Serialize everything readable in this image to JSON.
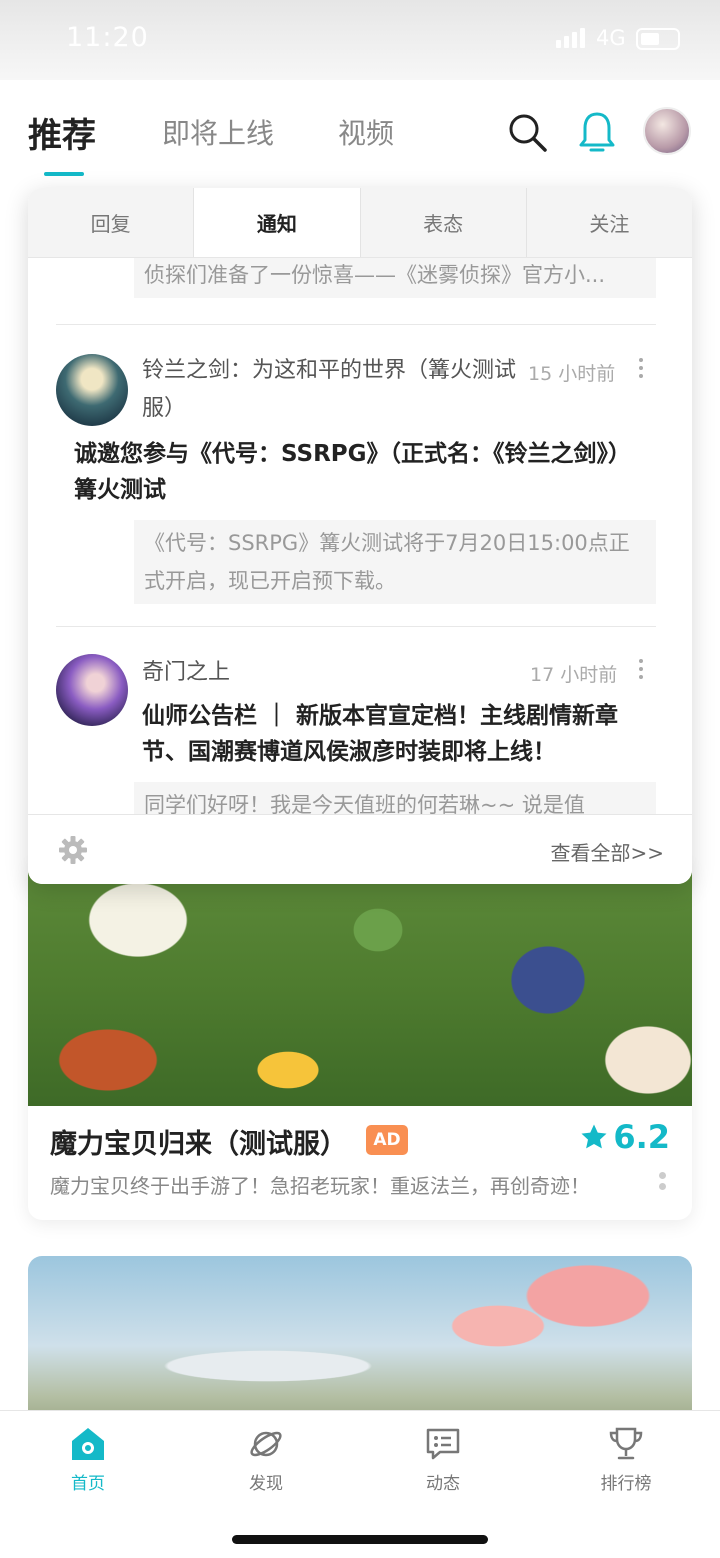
{
  "status": {
    "time": "11:20",
    "network": "4G"
  },
  "top_tabs": [
    {
      "label": "推荐",
      "active": true
    },
    {
      "label": "即将上线",
      "active": false
    },
    {
      "label": "视频",
      "active": false
    }
  ],
  "icons": {
    "search": "search-icon",
    "bell": "bell-icon",
    "avatar": "user-avatar",
    "settings": "gear-icon"
  },
  "colors": {
    "accent": "#14b9c8",
    "ad_badge": "#f98f52"
  },
  "panel": {
    "tabs": [
      {
        "label": "回复",
        "active": false
      },
      {
        "label": "通知",
        "active": true
      },
      {
        "label": "表态",
        "active": false
      },
      {
        "label": "关注",
        "active": false
      }
    ],
    "prev_quote": "侦探们准备了一份惊喜——《迷雾侦探》官方小...",
    "items": [
      {
        "sender": "铃兰之剑：为这和平的世界（篝火测试服）",
        "time": "15 小时前",
        "title": "诚邀您参与《代号：SSRPG》（正式名：《铃兰之剑》）篝火测试",
        "quote": "《代号：SSRPG》篝火测试将于7月20日15:00点正式开启，现已开启预下载。"
      },
      {
        "sender": "奇门之上",
        "time": "17 小时前",
        "title": "仙师公告栏 ｜ 新版本官宣定档！主线剧情新章节、国潮赛博道风侯淑彦时装即将上线！",
        "quote": "同学们好呀！我是今天值班的何若琳~~ 说是值"
      }
    ],
    "view_all": "查看全部>>"
  },
  "game_card": {
    "name": "魔力宝贝归来（测试服）",
    "badge": "AD",
    "rating": "6.2",
    "description": "魔力宝贝终于出手游了！急招老玩家！重返法兰，再创奇迹！"
  },
  "bottom_nav": [
    {
      "label": "首页",
      "icon": "home-icon",
      "active": true
    },
    {
      "label": "发现",
      "icon": "planet-icon",
      "active": false
    },
    {
      "label": "动态",
      "icon": "chat-icon",
      "active": false
    },
    {
      "label": "排行榜",
      "icon": "trophy-icon",
      "active": false
    }
  ]
}
